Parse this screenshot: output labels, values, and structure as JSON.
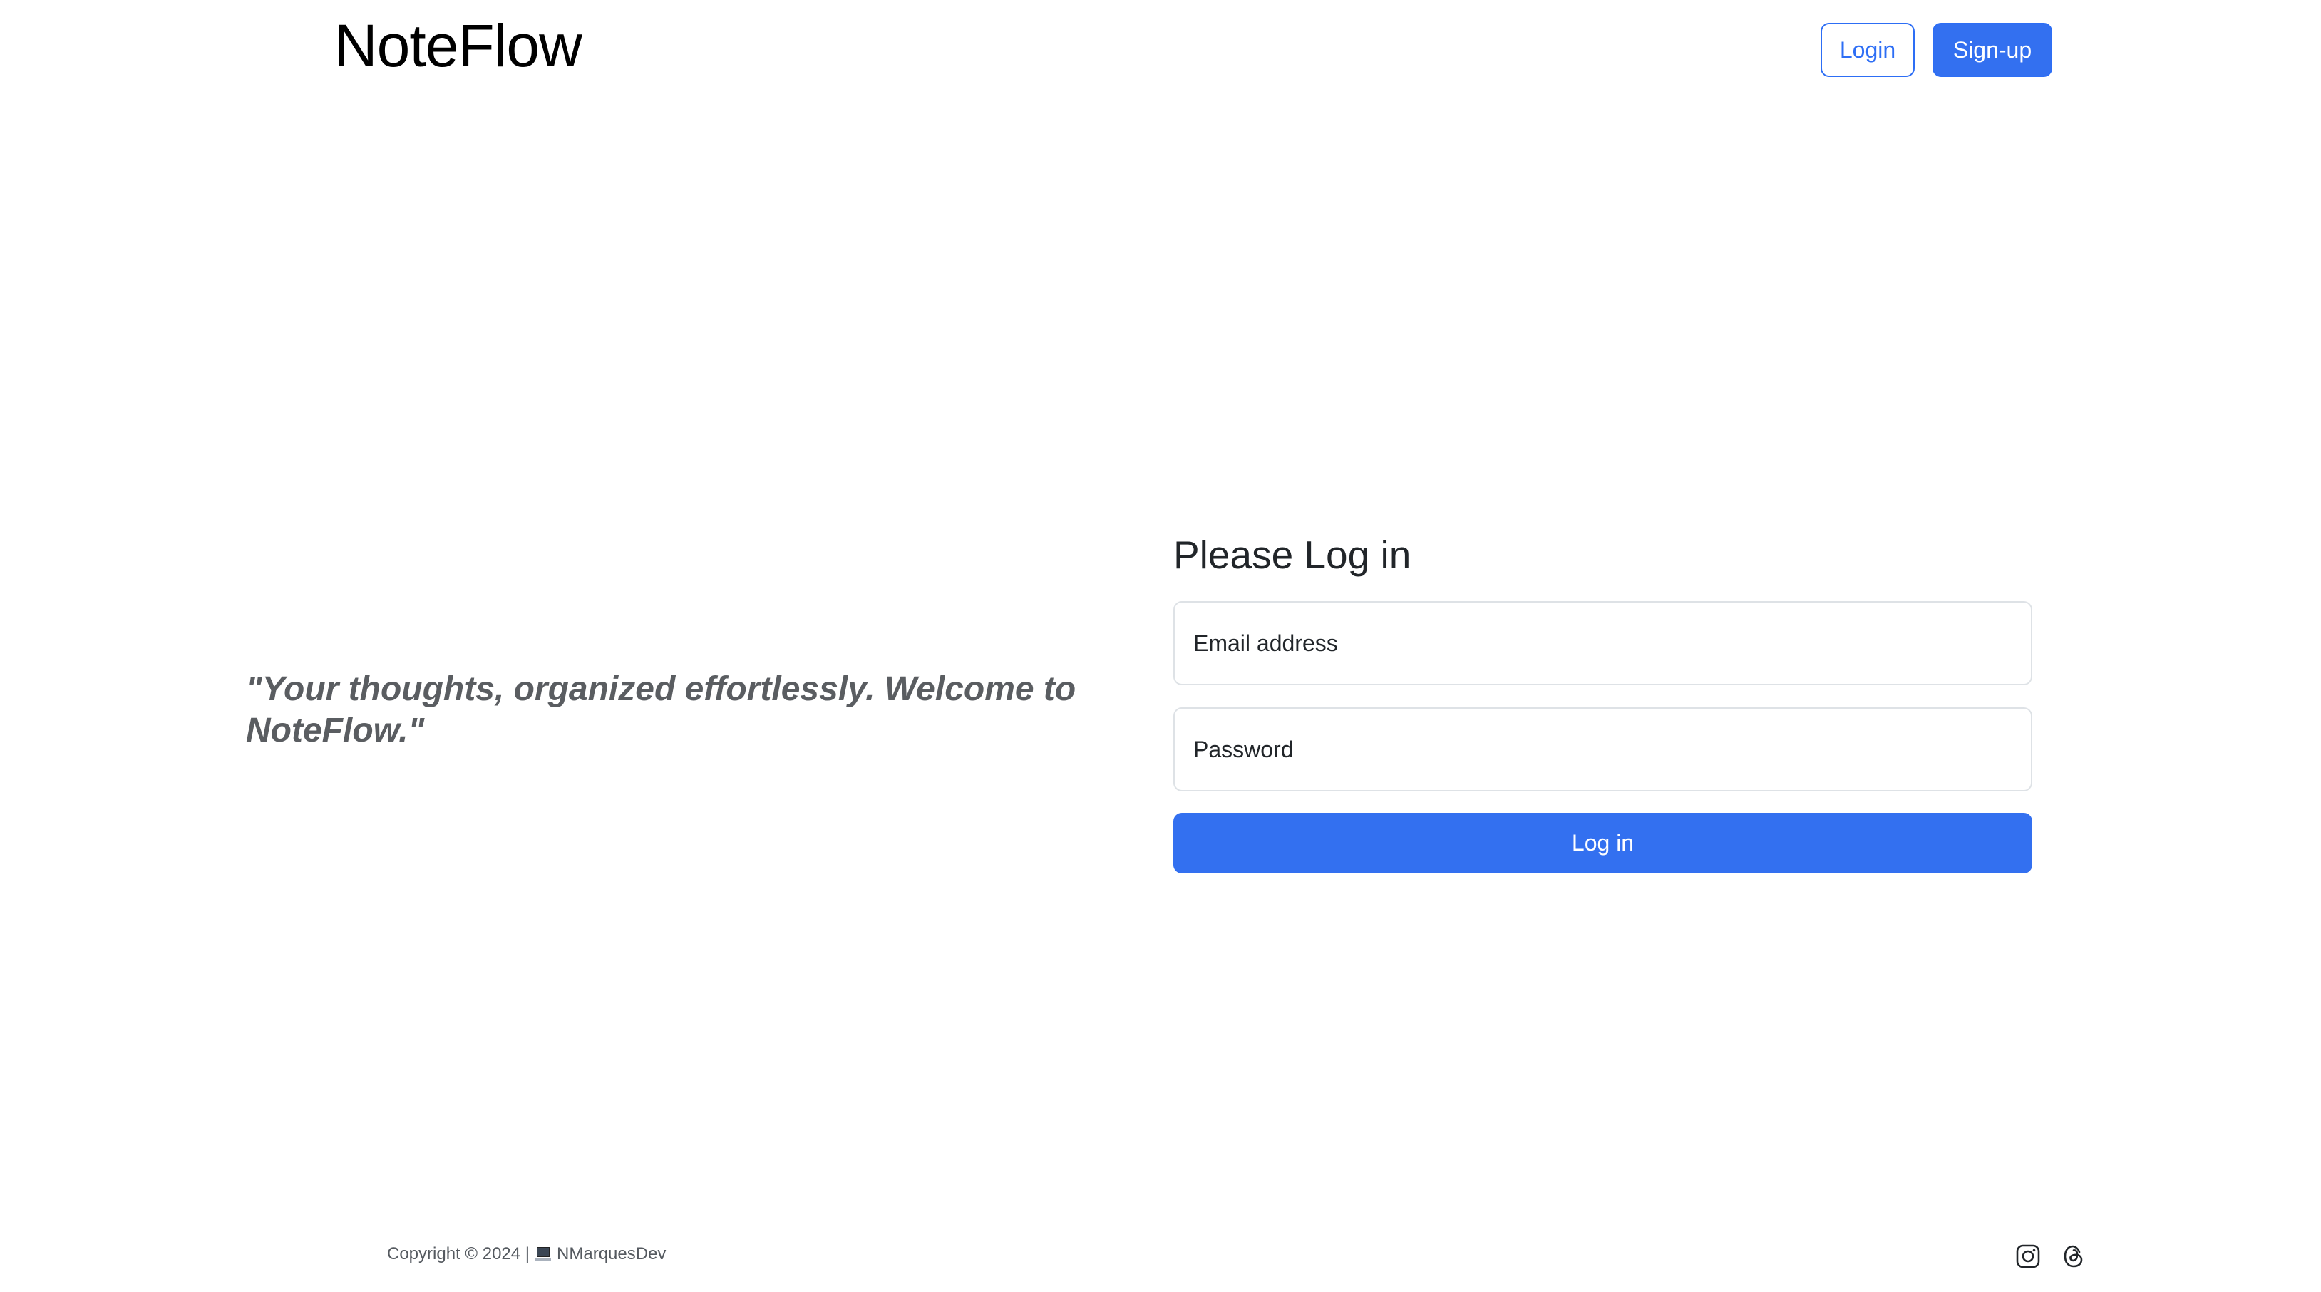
{
  "header": {
    "brand": "NoteFlow",
    "login_label": "Login",
    "signup_label": "Sign-up"
  },
  "hero": {
    "tagline": "\"Your thoughts, organized effortlessly. Welcome to NoteFlow.\""
  },
  "login_form": {
    "title": "Please Log in",
    "email_label": "Email address",
    "password_label": "Password",
    "submit_label": "Log in"
  },
  "footer": {
    "copyright": "Copyright © 2024 |",
    "author": "NMarquesDev",
    "icons": [
      "laptop-icon",
      "instagram-icon",
      "threads-icon"
    ]
  },
  "colors": {
    "primary": "#3370f0",
    "tagline": "#5a5d61",
    "border": "#dee2e6"
  }
}
